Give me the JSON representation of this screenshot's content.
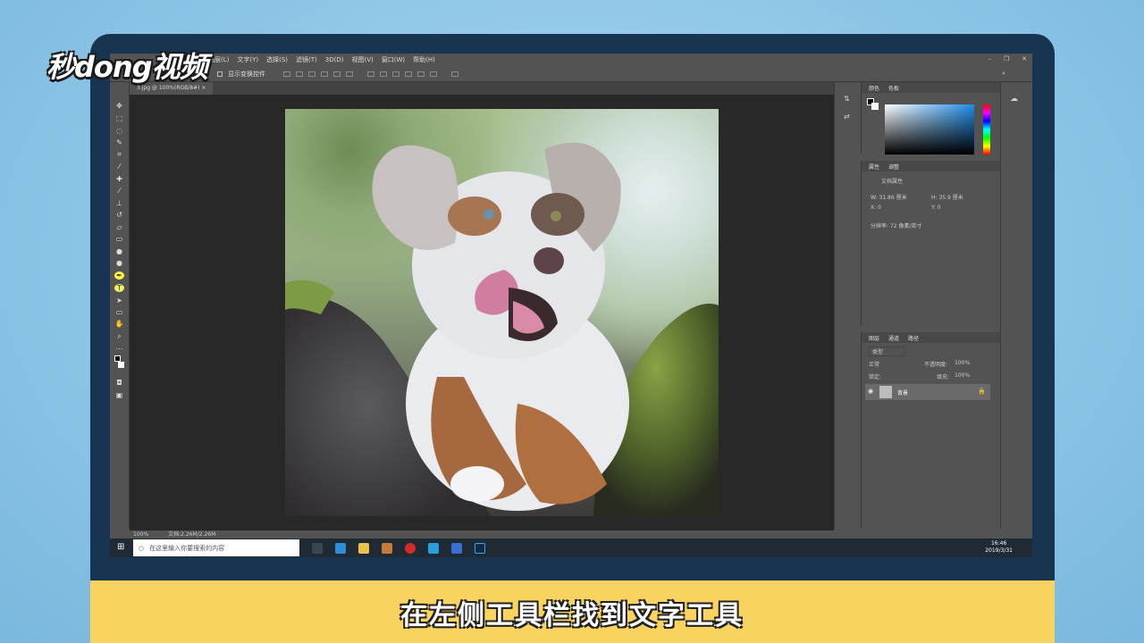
{
  "brand": {
    "logo_text": "秒dong视频"
  },
  "subtitle": "在左侧工具栏找到文字工具",
  "photoshop": {
    "menu": [
      "图层(L)",
      "文字(Y)",
      "选择(S)",
      "滤镜(T)",
      "3D(D)",
      "视图(V)",
      "窗口(W)",
      "帮助(H)"
    ],
    "options_bar": {
      "show_transform_label": "显示变换控件"
    },
    "document_tab": "3.jpg @ 100%(RGB/8#)",
    "status": {
      "zoom": "100%",
      "doc_size": "文档:2.26M/2.26M"
    },
    "color_panel": {
      "tabs": [
        "颜色",
        "色板"
      ]
    },
    "properties_panel": {
      "tabs": [
        "属性",
        "调整"
      ],
      "title": "文档属性",
      "width": "W: 31.86 厘米",
      "height": "H: 35.9 厘米",
      "x": "X: 0",
      "y": "Y: 0",
      "resolution": "分辨率: 72 像素/英寸"
    },
    "layers_panel": {
      "tabs": [
        "图层",
        "通道",
        "路径"
      ],
      "search_placeholder": "类型",
      "blend_mode": "正常",
      "opacity_label": "不透明度:",
      "opacity_value": "100%",
      "lock_label": "锁定:",
      "fill_label": "填充:",
      "fill_value": "100%",
      "layer_name": "背景"
    }
  },
  "taskbar": {
    "search_placeholder": "在这里输入你要搜索的内容",
    "time": "16:46",
    "date": "2019/3/31"
  },
  "colors": {
    "subtitle_bar": "#f9d360",
    "monitor_bezel": "#173551",
    "background": "#8fc6e6"
  }
}
